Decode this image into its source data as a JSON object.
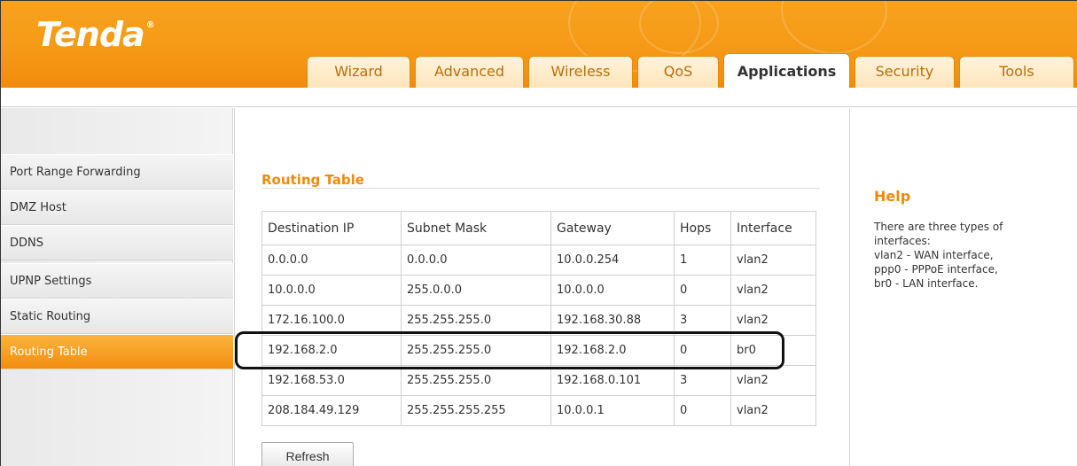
{
  "header": {
    "logo": "Tenda",
    "tabs": [
      "Wizard",
      "Advanced",
      "Wireless",
      "QoS",
      "Applications",
      "Security",
      "Tools"
    ],
    "active_tab": "Applications"
  },
  "sidebar": {
    "items": [
      {
        "label": "Port Range Forwarding"
      },
      {
        "label": "DMZ Host"
      },
      {
        "label": "DDNS"
      },
      {
        "label": "UPNP Settings"
      },
      {
        "label": "Static Routing"
      },
      {
        "label": "Routing Table"
      }
    ],
    "active_item": "Routing Table"
  },
  "main": {
    "title": "Routing Table",
    "table": {
      "headers": [
        "Destination IP",
        "Subnet Mask",
        "Gateway",
        "Hops",
        "Interface"
      ],
      "rows": [
        [
          "0.0.0.0",
          "0.0.0.0",
          "10.0.0.254",
          "1",
          "vlan2"
        ],
        [
          "10.0.0.0",
          "255.0.0.0",
          "10.0.0.0",
          "0",
          "vlan2"
        ],
        [
          "172.16.100.0",
          "255.255.255.0",
          "192.168.30.88",
          "3",
          "vlan2"
        ],
        [
          "192.168.2.0",
          "255.255.255.0",
          "192.168.2.0",
          "0",
          "br0"
        ],
        [
          "192.168.53.0",
          "255.255.255.0",
          "192.168.0.101",
          "3",
          "vlan2"
        ],
        [
          "208.184.49.129",
          "255.255.255.255",
          "10.0.0.1",
          "0",
          "vlan2"
        ]
      ],
      "highlighted_row": 3
    },
    "refresh_label": "Refresh"
  },
  "help": {
    "title": "Help",
    "lines": [
      "There are three types of interfaces:",
      "vlan2 - WAN interface,",
      "ppp0 - PPPoE interface,",
      "br0 - LAN interface."
    ]
  },
  "colors": {
    "accent": "#f39314",
    "title_orange": "#ef8a0d",
    "active_sidebar": "#f28e10"
  }
}
